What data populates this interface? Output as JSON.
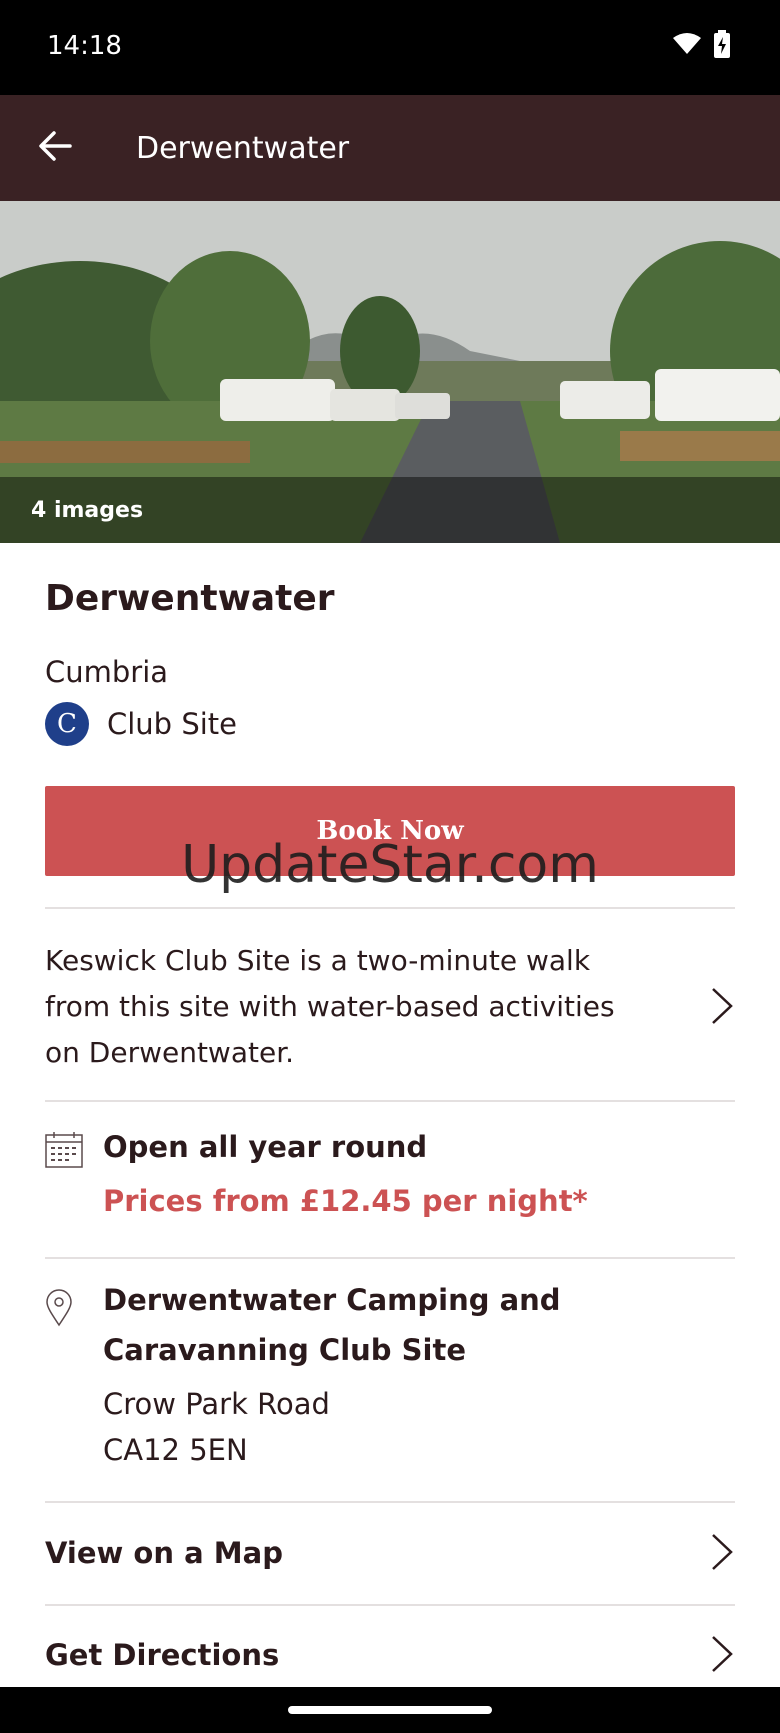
{
  "status": {
    "time": "14:18",
    "icons": [
      "wifi-icon",
      "battery-icon"
    ]
  },
  "app_bar": {
    "title": "Derwentwater",
    "back_icon": "arrow-left-icon"
  },
  "hero": {
    "image_count_label": "4 images"
  },
  "site": {
    "name": "Derwentwater",
    "region": "Cumbria",
    "type_badge": "C",
    "type_label": "Club Site"
  },
  "book_button": {
    "label": "Book Now"
  },
  "watermark": "UpdateStar.com",
  "description": "Keswick Club Site is a two-minute walk from this site with water-based activities on Derwentwater.",
  "availability": {
    "open_text": "Open all year round",
    "price_text": "Prices from £12.45 per night*"
  },
  "address": {
    "name": "Derwentwater Camping and Caravanning Club Site",
    "street": "Crow Park Road",
    "postcode": "CA12 5EN"
  },
  "links": {
    "map": "View on a Map",
    "directions": "Get Directions"
  },
  "colors": {
    "app_bar": "#3a2224",
    "accent": "#cc5253",
    "club_badge": "#1f3f8a"
  }
}
